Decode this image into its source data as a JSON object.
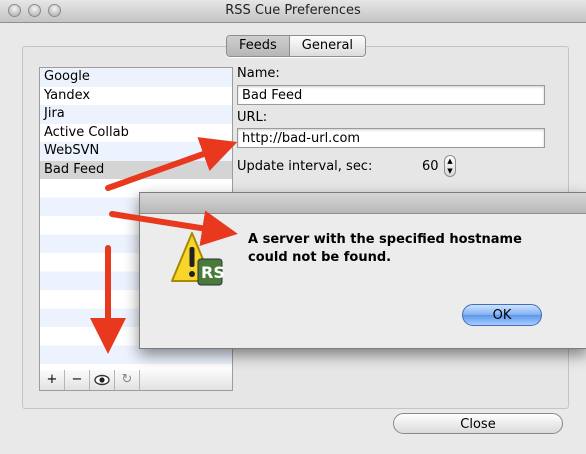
{
  "window": {
    "title": "RSS Cue Preferences"
  },
  "tabs": [
    {
      "label": "Feeds",
      "selected": true
    },
    {
      "label": "General",
      "selected": false
    }
  ],
  "feeds": {
    "items": [
      "Google",
      "Yandex",
      "Jira",
      "Active Collab",
      "WebSVN",
      "Bad Feed"
    ],
    "selected": "Bad Feed",
    "toolbar": {
      "add": "+",
      "remove": "−",
      "preview_icon": "eye-icon",
      "refresh_icon": "refresh-icon"
    }
  },
  "form": {
    "name_label": "Name:",
    "name_value": "Bad Feed",
    "url_label": "URL:",
    "url_value": "http://bad-url.com",
    "interval_label": "Update interval, sec:",
    "interval_value": "60"
  },
  "alert": {
    "message_line1": "A server with the specified hostname",
    "message_line2": "could not be found.",
    "ok_label": "OK",
    "icon": "warning-icon"
  },
  "footer": {
    "close_label": "Close"
  },
  "colors": {
    "annotation_arrow": "#e8391f",
    "alert_default_button": "#5b97ea",
    "list_selection": "#d4d4d4"
  }
}
